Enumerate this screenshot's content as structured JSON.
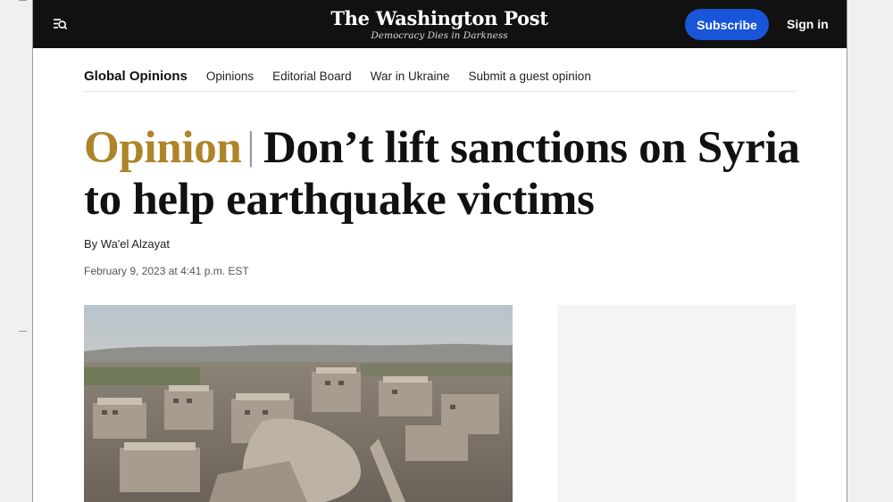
{
  "header": {
    "brand_name": "The Washington Post",
    "brand_tagline": "Democracy Dies in Darkness",
    "subscribe_label": "Subscribe",
    "signin_label": "Sign in",
    "menu_icon": "menu-search-icon"
  },
  "subnav": {
    "section": "Global Opinions",
    "links": [
      "Opinions",
      "Editorial Board",
      "War in Ukraine",
      "Submit a guest opinion"
    ]
  },
  "article": {
    "kicker": "Opinion",
    "separator": "|",
    "headline": "Don’t lift sanctions on Syria to help earthquake victims",
    "byline": "By Wa'el Alzayat",
    "dateline": "February 9, 2023 at 4:41 p.m. EST"
  },
  "colors": {
    "topbar": "#111111",
    "subscribe": "#1955d8",
    "kicker": "#ad8427"
  }
}
